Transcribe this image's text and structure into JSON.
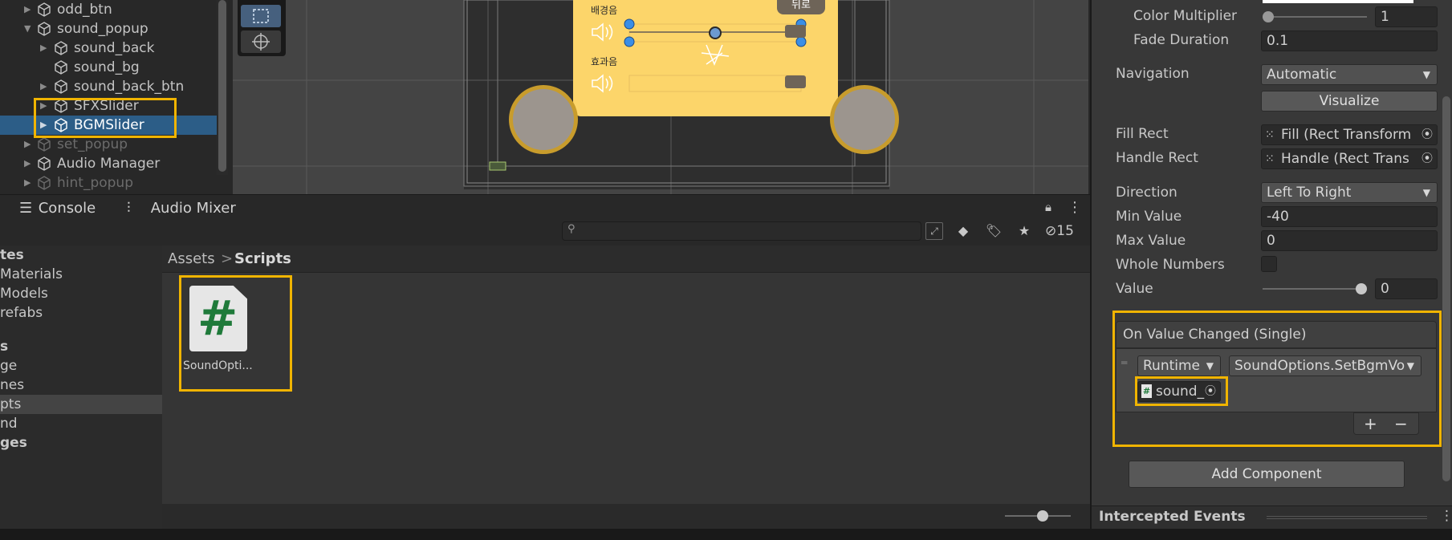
{
  "hierarchy": {
    "items": [
      {
        "label": "odd_btn",
        "expanded": false
      },
      {
        "label": "sound_popup",
        "expanded": true
      },
      {
        "label": "sound_back",
        "expanded": false
      },
      {
        "label": "sound_bg"
      },
      {
        "label": "sound_back_btn",
        "expanded": false
      },
      {
        "label": "SFXSlider",
        "expanded": false
      },
      {
        "label": "BGMSlider",
        "expanded": false,
        "selected": true
      },
      {
        "label": "set_popup",
        "expanded": false,
        "inactive": true
      },
      {
        "label": "Audio Manager",
        "expanded": false
      },
      {
        "label": "hint_popup",
        "expanded": false,
        "inactive": true
      }
    ]
  },
  "scene": {
    "popup_close_label": "뒤로",
    "bgm_label": "배경음",
    "sfx_label": "효과음"
  },
  "bottom_panel": {
    "tabs": [
      {
        "label": "Console",
        "icon": "console-icon"
      },
      {
        "label": "Audio Mixer",
        "icon": "mixer-icon"
      }
    ],
    "search_placeholder": "",
    "hidden_count": "15",
    "breadcrumb": {
      "root": "Assets",
      "separator": ">",
      "current": "Scripts"
    },
    "folders": [
      "tes",
      "Materials",
      "Models",
      "refabs",
      "s",
      "ge",
      "nes",
      "pts",
      "nd",
      "ges"
    ],
    "assets": [
      {
        "name": "SoundOpti...",
        "type": "csharp-script",
        "icon_text": "#"
      }
    ]
  },
  "inspector": {
    "color_multiplier": {
      "label": "Color Multiplier",
      "value": "1"
    },
    "fade_duration": {
      "label": "Fade Duration",
      "value": "0.1"
    },
    "navigation": {
      "label": "Navigation",
      "value": "Automatic"
    },
    "visualize_label": "Visualize",
    "fill_rect": {
      "label": "Fill Rect",
      "value": "Fill (Rect Transform"
    },
    "handle_rect": {
      "label": "Handle Rect",
      "value": "Handle (Rect Trans"
    },
    "direction": {
      "label": "Direction",
      "value": "Left To Right"
    },
    "min_value": {
      "label": "Min Value",
      "value": "-40"
    },
    "max_value": {
      "label": "Max Value",
      "value": "0"
    },
    "whole_numbers": {
      "label": "Whole Numbers",
      "checked": false
    },
    "value": {
      "label": "Value",
      "value": "0",
      "slider_fraction": 1.0
    },
    "event": {
      "header": "On Value Changed (Single)",
      "runtime": "Runtime",
      "function": "SoundOptions.SetBgmVo",
      "object": "sound_"
    },
    "add_component_label": "Add Component",
    "intercepted_events_label": "Intercepted Events"
  },
  "colors": {
    "highlight": "#f0b400",
    "selection": "#2c5d87",
    "popup": "#fcd56a",
    "accent_blue": "#3a8ee6"
  }
}
